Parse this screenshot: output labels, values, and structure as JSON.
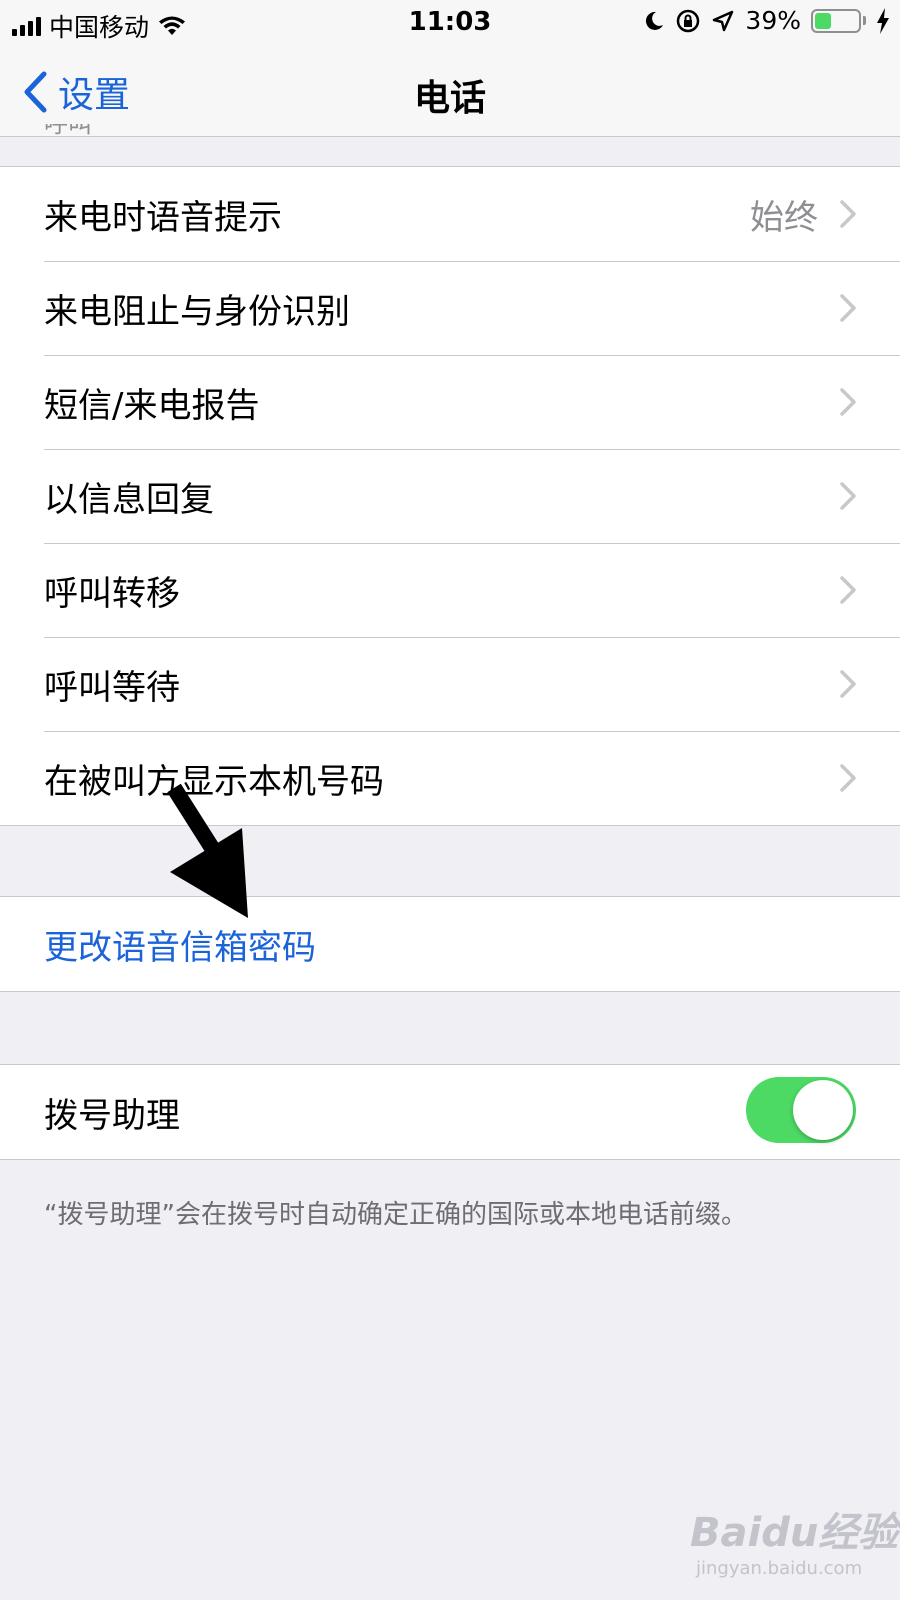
{
  "status_bar": {
    "carrier": "中国移动",
    "time": "11:03",
    "battery_percent_label": "39%",
    "battery_level": 0.39,
    "icons": [
      "signal-icon",
      "wifi-icon",
      "moon-icon",
      "orientation-lock-icon",
      "location-icon",
      "battery-icon",
      "charging-icon"
    ]
  },
  "nav": {
    "back_label": "设置",
    "title": "电话"
  },
  "section_header": "呼叫",
  "calls_group": {
    "rows": [
      {
        "label": "来电时语音提示",
        "value": "始终"
      },
      {
        "label": "来电阻止与身份识别"
      },
      {
        "label": "短信/来电报告"
      },
      {
        "label": "以信息回复"
      },
      {
        "label": "呼叫转移"
      },
      {
        "label": "呼叫等待"
      },
      {
        "label": "在被叫方显示本机号码"
      }
    ]
  },
  "voicemail_group": {
    "link_label": "更改语音信箱密码"
  },
  "dial_assist_group": {
    "label": "拨号助理",
    "toggle_on": true,
    "footer": "“拨号助理”会在拨号时自动确定正确的国际或本地电话前缀。"
  },
  "watermark": {
    "logo": "Baidu经验",
    "sub": "jingyan.baidu.com"
  },
  "colors": {
    "accent": "#1a63d8",
    "toggle_on": "#4cd964",
    "background": "#efeff4",
    "separator": "#c8c7cc",
    "secondary_text": "#8e8e93"
  }
}
